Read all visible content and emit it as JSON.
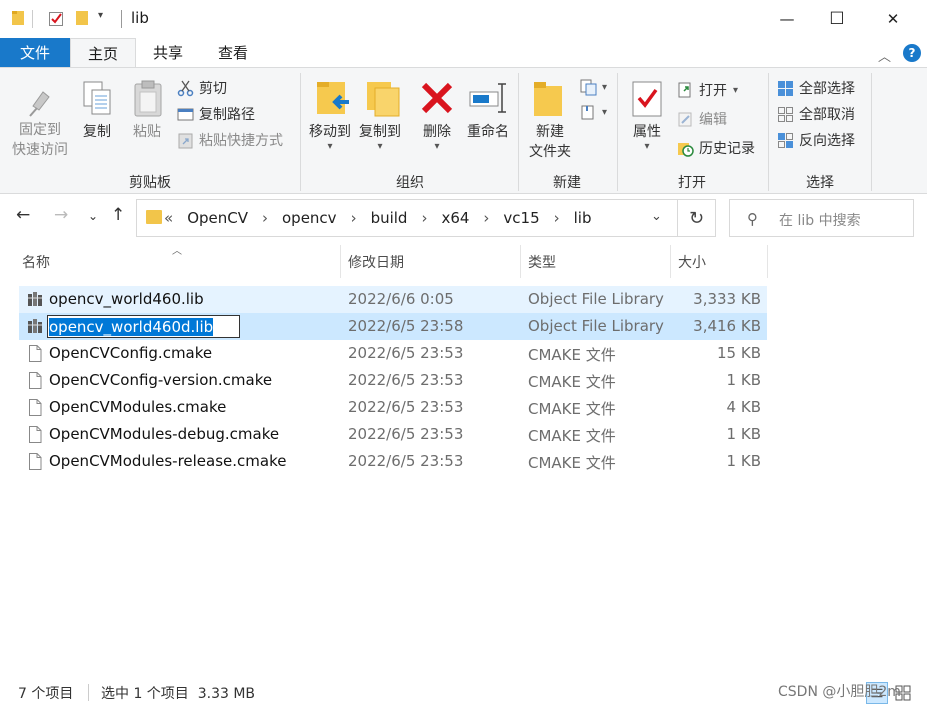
{
  "window": {
    "title": "lib",
    "controls": {
      "minimize": "—",
      "maximize": "☐",
      "close": "✕"
    }
  },
  "ribbon": {
    "file_tab": "文件",
    "tabs": [
      "主页",
      "共享",
      "查看"
    ],
    "active_tab": "主页",
    "groups": {
      "clipboard": {
        "label": "剪贴板",
        "pin": [
          "固定到",
          "快速访问"
        ],
        "copy": "复制",
        "paste": "粘贴",
        "cut": "剪切",
        "copy_path": "复制路径",
        "paste_shortcut": "粘贴快捷方式"
      },
      "organize": {
        "label": "组织",
        "move_to": "移动到",
        "copy_to": "复制到",
        "delete": "删除",
        "rename": "重命名"
      },
      "new": {
        "label": "新建",
        "new_folder": [
          "新建",
          "文件夹"
        ]
      },
      "open": {
        "label": "打开",
        "properties": "属性",
        "open": "打开",
        "edit": "编辑",
        "history": "历史记录"
      },
      "select": {
        "label": "选择",
        "select_all": "全部选择",
        "select_none": "全部取消",
        "invert": "反向选择"
      }
    }
  },
  "address": {
    "prefix": "«",
    "path": [
      "OpenCV",
      "opencv",
      "build",
      "x64",
      "vc15",
      "lib"
    ],
    "search_placeholder": "在 lib 中搜索"
  },
  "columns": [
    "名称",
    "修改日期",
    "类型",
    "大小"
  ],
  "files": [
    {
      "name": "opencv_world460.lib",
      "date": "2022/6/6 0:05",
      "type": "Object File Library",
      "size": "3,333 KB",
      "icon": "lib-icon",
      "state": "hover"
    },
    {
      "name": "opencv_world460d.lib",
      "date": "2022/6/5 23:58",
      "type": "Object File Library",
      "size": "3,416 KB",
      "icon": "lib-icon",
      "state": "renaming"
    },
    {
      "name": "OpenCVConfig.cmake",
      "date": "2022/6/5 23:53",
      "type": "CMAKE 文件",
      "size": "15 KB",
      "icon": "file-icon",
      "state": "normal"
    },
    {
      "name": "OpenCVConfig-version.cmake",
      "date": "2022/6/5 23:53",
      "type": "CMAKE 文件",
      "size": "1 KB",
      "icon": "file-icon",
      "state": "normal"
    },
    {
      "name": "OpenCVModules.cmake",
      "date": "2022/6/5 23:53",
      "type": "CMAKE 文件",
      "size": "4 KB",
      "icon": "file-icon",
      "state": "normal"
    },
    {
      "name": "OpenCVModules-debug.cmake",
      "date": "2022/6/5 23:53",
      "type": "CMAKE 文件",
      "size": "1 KB",
      "icon": "file-icon",
      "state": "normal"
    },
    {
      "name": "OpenCVModules-release.cmake",
      "date": "2022/6/5 23:53",
      "type": "CMAKE 文件",
      "size": "1 KB",
      "icon": "file-icon",
      "state": "normal"
    }
  ],
  "status": {
    "item_count": "7 个项目",
    "selection": "选中 1 个项目  3.33 MB"
  },
  "watermark": "CSDN @小胆胆2m",
  "colors": {
    "accent": "#1979ca",
    "selected_row": "#cce8ff",
    "hover_row": "#e5f3ff",
    "folder": "#f2c54a",
    "delete_red": "#d9141e"
  }
}
